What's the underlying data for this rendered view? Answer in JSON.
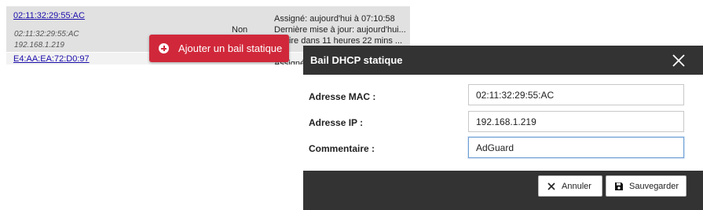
{
  "lease_table": {
    "rows": [
      {
        "mac": "02:11:32:29:55:AC",
        "mac_sub": "02:11:32:29:55:AC",
        "ip_sub": "192.168.1.219",
        "static": "Non",
        "assigned": "Assigné: aujourd'hui à 07:10:58",
        "updated": "Dernière mise à jour: aujourd'hui...",
        "expires": "Expire dans 11 heures 22 mins ..."
      },
      {
        "mac": "E4:AA:EA:72:D0:97",
        "assigned": "Assigné: aujourd'hui"
      }
    ]
  },
  "add_static_button": {
    "label": "Ajouter un bail statique",
    "icon": "plus-circle-icon",
    "color": "#d0283a"
  },
  "dialog": {
    "title": "Bail DHCP statique",
    "close_icon": "close-icon",
    "fields": {
      "mac": {
        "label": "Adresse MAC :",
        "value": "02:11:32:29:55:AC"
      },
      "ip": {
        "label": "Adresse IP :",
        "value": "192.168.1.219"
      },
      "comment": {
        "label": "Commentaire :",
        "value": "AdGuard"
      }
    },
    "buttons": {
      "cancel": {
        "label": "Annuler",
        "icon": "close-icon"
      },
      "save": {
        "label": "Sauvegarder",
        "icon": "save-icon"
      }
    },
    "header_color": "#333333"
  }
}
